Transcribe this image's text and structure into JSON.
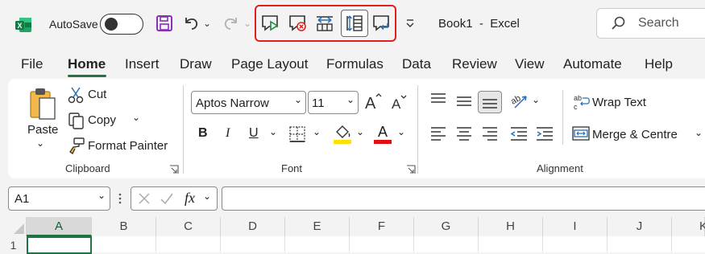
{
  "titlebar": {
    "autosave_label": "AutoSave",
    "autosave_state": "Off",
    "document_title": "Book1  -  Excel",
    "search_placeholder": "Search",
    "highlight_color": "#e02020"
  },
  "qat_icons": [
    "excel-logo-icon",
    "save-icon",
    "undo-icon",
    "redo-icon",
    "comment-play-icon",
    "comment-cancel-icon",
    "column-width-icon",
    "row-height-icon",
    "comment-reply-icon",
    "customize-qat-icon"
  ],
  "tabs": [
    "File",
    "Home",
    "Insert",
    "Draw",
    "Page Layout",
    "Formulas",
    "Data",
    "Review",
    "View",
    "Automate",
    "Help"
  ],
  "active_tab": "Home",
  "clipboard": {
    "paste": "Paste",
    "cut": "Cut",
    "copy": "Copy",
    "format_painter": "Format Painter",
    "group_label": "Clipboard"
  },
  "font": {
    "font_name": "Aptos Narrow",
    "font_size": "11",
    "bold": "B",
    "italic": "I",
    "underline": "U",
    "font_color_letter": "A",
    "group_label": "Font",
    "fill_color": "#ffe000",
    "text_color": "#e01010"
  },
  "alignment": {
    "wrap_text": "Wrap Text",
    "merge_centre": "Merge & Centre",
    "group_label": "Alignment"
  },
  "formula_bar": {
    "name_box": "A1",
    "fx": "fx",
    "value": ""
  },
  "columns": [
    "A",
    "B",
    "C",
    "D",
    "E",
    "F",
    "G",
    "H",
    "I",
    "J",
    "K"
  ],
  "rows": [
    "1"
  ],
  "accent": "#217346"
}
